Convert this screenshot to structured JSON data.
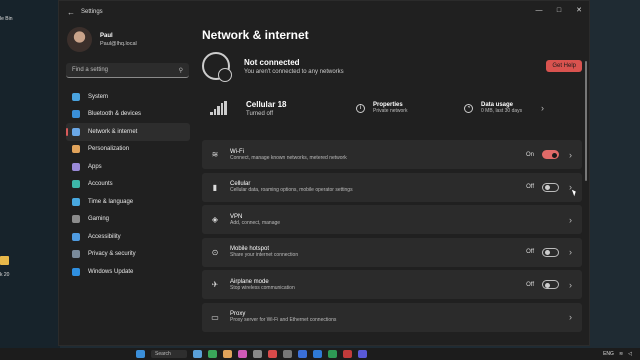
{
  "desktop": {
    "items": [
      {
        "label": "le Bin"
      },
      {
        "label": "k 20"
      }
    ]
  },
  "window": {
    "title": "Settings",
    "back_icon": "arrow-left-icon",
    "controls": [
      "—",
      "□",
      "✕"
    ]
  },
  "profile": {
    "name": "Paul",
    "email": "Paul@lhq.local"
  },
  "search": {
    "placeholder": "Find a setting",
    "icon": "search-icon"
  },
  "sidebar": {
    "items": [
      {
        "label": "System",
        "color": "#4aa3df",
        "active": false
      },
      {
        "label": "Bluetooth & devices",
        "color": "#3a8fd8",
        "active": false
      },
      {
        "label": "Network & internet",
        "color": "#6aa7e6",
        "active": true
      },
      {
        "label": "Personalization",
        "color": "#e0a35b",
        "active": false
      },
      {
        "label": "Apps",
        "color": "#9a8ad8",
        "active": false
      },
      {
        "label": "Accounts",
        "color": "#3db6a8",
        "active": false
      },
      {
        "label": "Time & language",
        "color": "#48a8e0",
        "active": false
      },
      {
        "label": "Gaming",
        "color": "#8c8c8c",
        "active": false
      },
      {
        "label": "Accessibility",
        "color": "#4f9be0",
        "active": false
      },
      {
        "label": "Privacy & security",
        "color": "#7a8a9a",
        "active": false
      },
      {
        "label": "Windows Update",
        "color": "#2f8fe0",
        "active": false
      }
    ]
  },
  "main": {
    "title": "Network & internet",
    "status": {
      "title": "Not connected",
      "subtitle": "You aren't connected to any networks",
      "help_label": "Get Help"
    },
    "cellular": {
      "name": "Cellular 18",
      "state": "Turned off"
    },
    "properties": {
      "title": "Properties",
      "subtitle": "Private network"
    },
    "data_usage": {
      "title": "Data usage",
      "subtitle": "0 MB, last 30 days"
    },
    "rows": [
      {
        "icon": "wifi-icon",
        "glyph": "≋",
        "title": "Wi-Fi",
        "subtitle": "Connect, manage known networks, metered network",
        "state": "On",
        "toggle": "on"
      },
      {
        "icon": "cellular-icon",
        "glyph": "▮",
        "title": "Cellular",
        "subtitle": "Cellular data, roaming options, mobile operator settings",
        "state": "Off",
        "toggle": "off"
      },
      {
        "icon": "vpn-shield-icon",
        "glyph": "◈",
        "title": "VPN",
        "subtitle": "Add, connect, manage",
        "state": "",
        "toggle": ""
      },
      {
        "icon": "hotspot-icon",
        "glyph": "⊙",
        "title": "Mobile hotspot",
        "subtitle": "Share your internet connection",
        "state": "Off",
        "toggle": "off"
      },
      {
        "icon": "airplane-icon",
        "glyph": "✈",
        "title": "Airplane mode",
        "subtitle": "Stop wireless communication",
        "state": "Off",
        "toggle": "off"
      },
      {
        "icon": "proxy-icon",
        "glyph": "▭",
        "title": "Proxy",
        "subtitle": "Proxy server for Wi-Fi and Ethernet connections",
        "state": "",
        "toggle": ""
      }
    ]
  },
  "taskbar": {
    "search_label": "Search",
    "tray_lang": "ENG"
  }
}
